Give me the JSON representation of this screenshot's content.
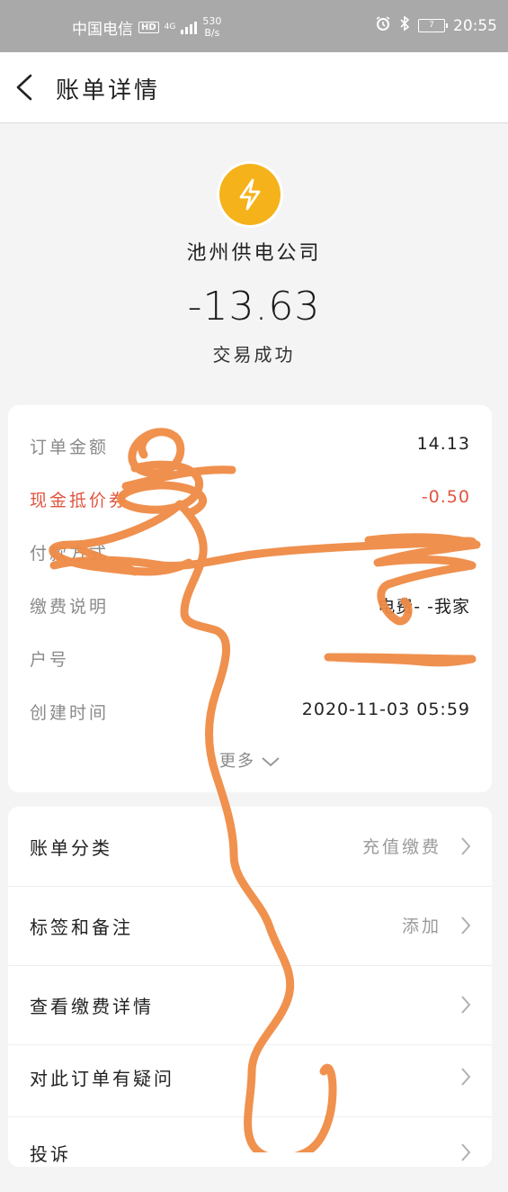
{
  "status_bar": {
    "carrier": "中国电信",
    "hd": "HD",
    "network": "4G",
    "speed_value": "530",
    "speed_unit": "B/s",
    "battery": "7",
    "time": "20:55"
  },
  "nav": {
    "title": "账单详情"
  },
  "merchant": {
    "name": "池州供电公司",
    "icon": "lightning-icon",
    "icon_color": "#f6b21b"
  },
  "amount": "-13.63",
  "status": "交易成功",
  "details": [
    {
      "label": "订单金额",
      "value": "14.13"
    },
    {
      "label": "现金抵价券",
      "value": "-0.50"
    },
    {
      "label": "付款方式",
      "value": ""
    },
    {
      "label": "缴费说明",
      "value": "电费-  -我家"
    },
    {
      "label": "户号",
      "value": ""
    },
    {
      "label": "创建时间",
      "value": "2020-11-03 05:59"
    }
  ],
  "more_label": "更多",
  "menu": [
    {
      "label": "账单分类",
      "value": "充值缴费"
    },
    {
      "label": "标签和备注",
      "value": "添加"
    },
    {
      "label": "查看缴费详情",
      "value": ""
    },
    {
      "label": "对此订单有疑问",
      "value": ""
    },
    {
      "label": "投诉",
      "value": ""
    }
  ],
  "colors": {
    "accent_red": "#e0553f",
    "scribble": "#ef8b45"
  }
}
